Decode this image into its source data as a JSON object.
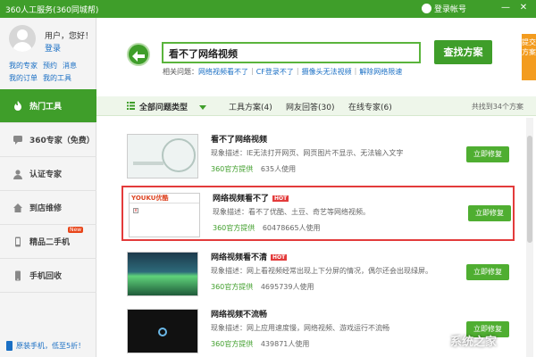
{
  "window": {
    "title": "360人工服务(360同城帮)",
    "login_label": "登录帐号",
    "minimize": "—",
    "close": "✕"
  },
  "sidebar": {
    "greeting": "用户，您好！",
    "login": "登录",
    "quick_row1": [
      "我的专家",
      "预约",
      "消息"
    ],
    "quick_row2": [
      "我的订单",
      "我的工具"
    ],
    "items": [
      {
        "label": "热门工具",
        "icon": "flame-icon",
        "active": true
      },
      {
        "label": "360专家（免费）",
        "icon": "chat-icon"
      },
      {
        "label": "认证专家",
        "icon": "person-icon"
      },
      {
        "label": "到店维修",
        "icon": "home-icon"
      },
      {
        "label": "精品二手机",
        "icon": "phone-icon",
        "badge": "New"
      },
      {
        "label": "手机回收",
        "icon": "recycle-icon"
      }
    ],
    "promo": "原装手机，低至5折！"
  },
  "search": {
    "query": "看不了网络视频",
    "button": "查找方案",
    "related_label": "相关问题：",
    "related": [
      "网络视频看不了",
      "CF登录不了",
      "摄像头无法视频",
      "解除网络限速"
    ]
  },
  "feedback_tab": "提交方案",
  "tabs": {
    "all": "全部问题类型",
    "items": [
      "工具方案(4)",
      "网友回答(30)",
      "在线专家(6)"
    ],
    "total": "共找到34个方案"
  },
  "results": [
    {
      "title": "看不了网络视频",
      "hot": false,
      "desc": "现象描述：IE无法打开网页、网页图片不显示、无法输入文字",
      "provider": "360官方提供",
      "uses": "635人使用",
      "button": "立即修复"
    },
    {
      "title": "网络视频看不了",
      "hot": true,
      "desc": "现象描述：看不了优酷、土豆、奇艺等网络视频。",
      "provider": "360官方提供",
      "uses": "60478665人使用",
      "button": "立即修复",
      "thumb_logo": "YOUKU优酷"
    },
    {
      "title": "网络视频看不清",
      "hot": true,
      "desc": "现象描述：网上看视频经常出现上下分屏的情况，偶尔还会出现绿屏。",
      "provider": "360官方提供",
      "uses": "4695739人使用",
      "button": "立即修复"
    },
    {
      "title": "网络视频不流畅",
      "hot": false,
      "desc": "现象描述：网上应用速度慢，网络视频、游戏运行不流畅",
      "provider": "360官方提供",
      "uses": "439871人使用",
      "button": "立即修复"
    }
  ],
  "hot_label": "HOT",
  "watermark": "系统之家",
  "colors": {
    "brand_green": "#3f9e2a",
    "highlight_red": "#e33b3b",
    "link_blue": "#1a6fc4",
    "feedback_orange": "#f39c1f"
  }
}
